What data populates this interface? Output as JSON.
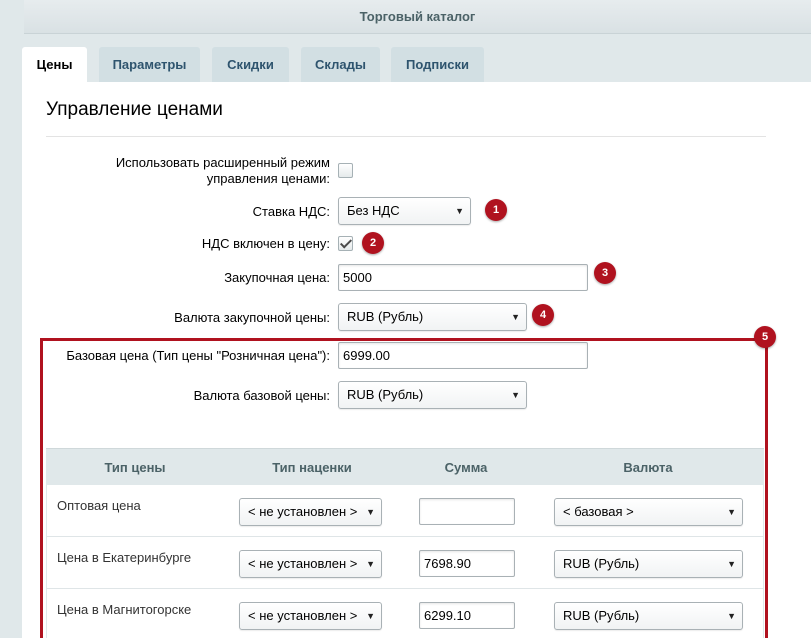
{
  "header": {
    "title": "Торговый каталог"
  },
  "tabs": [
    {
      "label": "Цены",
      "active": true
    },
    {
      "label": "Параметры",
      "active": false
    },
    {
      "label": "Скидки",
      "active": false
    },
    {
      "label": "Склады",
      "active": false
    },
    {
      "label": "Подписки",
      "active": false
    }
  ],
  "section": {
    "title": "Управление ценами"
  },
  "form": {
    "advanced_mode_label_1": "Использовать расширенный режим",
    "advanced_mode_label_2": "управления ценами:",
    "advanced_mode_checked": false,
    "vat_rate_label": "Ставка НДС:",
    "vat_rate_value": "Без НДС",
    "vat_included_label": "НДС включен в цену:",
    "vat_included_checked": true,
    "purchase_price_label": "Закупочная цена:",
    "purchase_price_value": "5000",
    "purchase_currency_label": "Валюта закупочной цены:",
    "purchase_currency_value": "RUB (Рубль)",
    "base_price_label": "Базовая цена (Тип цены \"Розничная цена\"):",
    "base_price_value": "6999.00",
    "base_currency_label": "Валюта базовой цены:",
    "base_currency_value": "RUB (Рубль)"
  },
  "badges": [
    "1",
    "2",
    "3",
    "4",
    "5"
  ],
  "table": {
    "columns": [
      "Тип цены",
      "Тип наценки",
      "Сумма",
      "Валюта"
    ],
    "rows": [
      {
        "name": "Оптовая цена",
        "markup": "< не установлен >",
        "amount": "",
        "currency": "< базовая >"
      },
      {
        "name": "Цена в Екатеринбурге",
        "markup": "< не установлен >",
        "amount": "7698.90",
        "currency": "RUB (Рубль)"
      },
      {
        "name": "Цена в Магнитогорске",
        "markup": "< не установлен >",
        "amount": "6299.10",
        "currency": "RUB (Рубль)"
      }
    ]
  },
  "colors": {
    "accent_badge": "#b0121f",
    "tab_inactive": "#d2dfe3",
    "header_text": "#4b6267"
  },
  "icons": {
    "dropdown": "chevron-down-icon",
    "checkbox_check": "check-icon"
  }
}
